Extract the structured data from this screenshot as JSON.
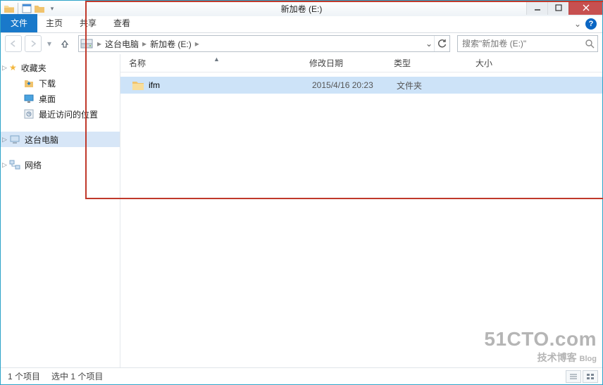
{
  "window": {
    "title": "新加卷 (E:)"
  },
  "ribbon": {
    "file": "文件",
    "tabs": [
      "主页",
      "共享",
      "查看"
    ]
  },
  "address": {
    "crumbs": [
      "这台电脑",
      "新加卷 (E:)"
    ]
  },
  "search": {
    "placeholder": "搜索\"新加卷 (E:)\""
  },
  "sidebar": {
    "favorites": {
      "label": "收藏夹",
      "items": [
        "下载",
        "桌面",
        "最近访问的位置"
      ]
    },
    "thispc": {
      "label": "这台电脑"
    },
    "network": {
      "label": "网络"
    }
  },
  "columns": {
    "name": "名称",
    "date": "修改日期",
    "type": "类型",
    "size": "大小"
  },
  "rows": [
    {
      "name": "ifm",
      "date": "2015/4/16 20:23",
      "type": "文件夹",
      "size": ""
    }
  ],
  "status": {
    "count": "1 个项目",
    "selected": "选中 1 个项目"
  },
  "watermark": {
    "site": "51CTO.com",
    "tag": "技术博客",
    "blog": "Blog"
  }
}
